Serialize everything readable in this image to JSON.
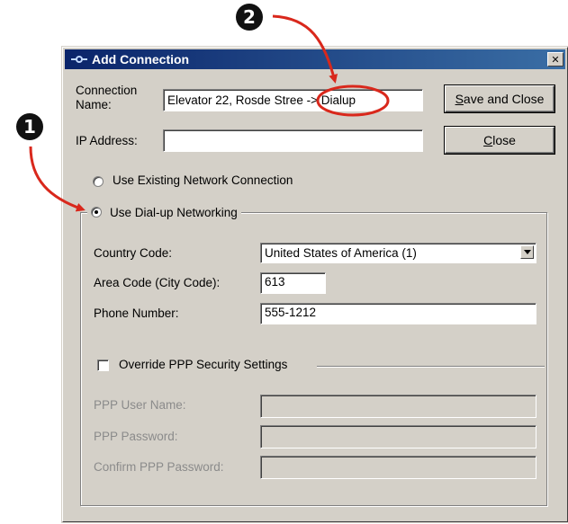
{
  "callouts": [
    {
      "number": "❶",
      "label_glyph": "1"
    },
    {
      "number": "❷",
      "label_glyph": "2"
    }
  ],
  "callout_color": "#d9281c",
  "window": {
    "title": "Add Connection",
    "title_icon": "network-connection-icon",
    "close_glyph": "✕"
  },
  "form": {
    "connection_name_label": "Connection Name:",
    "connection_name_value": "Elevator 22, Rosde Stree -> Dialup",
    "ip_address_label": "IP Address:",
    "ip_address_value": ""
  },
  "buttons": {
    "save_close_prefix": "",
    "save_close_accel": "S",
    "save_close_rest": "ave and Close",
    "close_accel": "C",
    "close_rest": "lose"
  },
  "connection_type": {
    "existing_label": "Use Existing Network Connection",
    "dialup_label": "Use Dial-up Networking",
    "selected": "dialup"
  },
  "dialup": {
    "country_code_label": "Country Code:",
    "country_code_value": "United States of America (1)",
    "area_code_label": "Area Code (City Code):",
    "area_code_value": "613",
    "phone_number_label": "Phone Number:",
    "phone_number_value": "555-1212"
  },
  "ppp": {
    "override_label": "Override PPP Security Settings",
    "override_checked": false,
    "user_name_label": "PPP User Name:",
    "password_label": "PPP Password:",
    "confirm_password_label": "Confirm PPP Password:",
    "user_name_value": "",
    "password_value": "",
    "confirm_password_value": ""
  },
  "colors": {
    "titlebar_start": "#0a246a",
    "titlebar_end": "#3a6ea5",
    "dialog_face": "#d4d0c8",
    "disabled_text": "#8b8b8b"
  }
}
